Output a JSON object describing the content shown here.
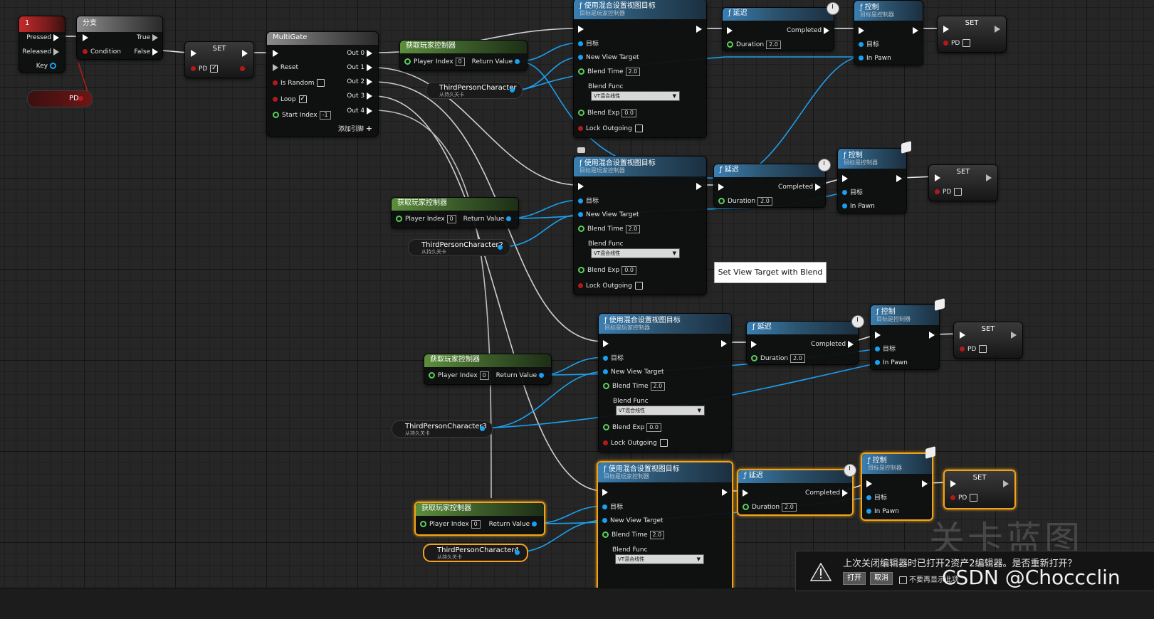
{
  "key_node": {
    "title": "1",
    "pins": [
      "Pressed",
      "Released",
      "Key"
    ]
  },
  "pd_getter": {
    "label": "PD"
  },
  "branch": {
    "title": "分支",
    "condition": "Condition",
    "true_label": "True",
    "false_label": "False"
  },
  "set_main": {
    "title": "SET",
    "pin": "PD",
    "checked": true
  },
  "multigate": {
    "title": "MultiGate",
    "reset": "Reset",
    "is_random": "Is Random",
    "loop": "Loop",
    "start_index": "Start Index",
    "start_index_value": "-1",
    "outs": [
      "Out 0",
      "Out 1",
      "Out 2",
      "Out 3",
      "Out 4"
    ],
    "add_pin": "添加引脚"
  },
  "get_pc": {
    "title": "获取玩家控制器",
    "player_index": "Player Index",
    "index_value": "0",
    "return_value": "Return Value"
  },
  "chars": [
    {
      "name": "ThirdPersonCharacter",
      "sub": "从持久关卡"
    },
    {
      "name": "ThirdPersonCharacter2",
      "sub": "从持久关卡"
    },
    {
      "name": "ThirdPersonCharacter3",
      "sub": "从持久关卡"
    },
    {
      "name": "ThirdPersonCharacter4",
      "sub": "从持久关卡"
    }
  ],
  "blend": {
    "title": "使用混合设置视图目标",
    "sub": "目标是玩家控制器",
    "target": "目标",
    "new_view_target": "New View Target",
    "blend_time": "Blend Time",
    "blend_time_value": "2.0",
    "blend_func": "Blend Func",
    "blend_func_value": "VT混合线性",
    "blend_exp": "Blend Exp",
    "blend_exp_value": "0.0",
    "lock_outgoing": "Lock Outgoing"
  },
  "delay": {
    "title": "延迟",
    "completed": "Completed",
    "duration": "Duration",
    "duration_value": "2.0"
  },
  "possess": {
    "title": "控制",
    "sub": "目标是控制器",
    "target": "目标",
    "in_pawn": "In Pawn"
  },
  "set_small": {
    "title": "SET",
    "pin": "PD"
  },
  "tooltip": "Set View Target with Blend",
  "watermark": "关卡蓝图",
  "notification": {
    "message": "上次关闭编辑器时已打开2资产2编辑器。是否重新打开？",
    "open": "打开",
    "cancel": "取消",
    "dont_show": "不要再显示此项"
  },
  "credit": "CSDN @Choccclin"
}
